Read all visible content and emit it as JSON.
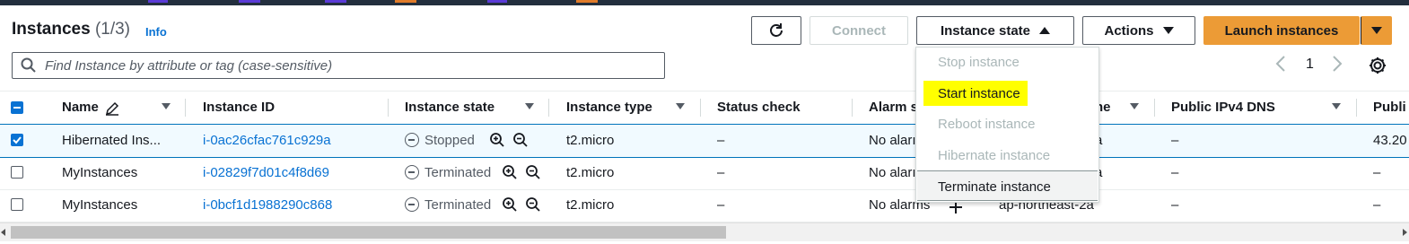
{
  "header": {
    "title": "Instances",
    "count": "(1/3)",
    "info": "Info"
  },
  "toolbar": {
    "connect": "Connect",
    "instance_state": "Instance state",
    "actions": "Actions",
    "launch": "Launch instances"
  },
  "search": {
    "placeholder": "Find Instance by attribute or tag (case-sensitive)"
  },
  "pagination": {
    "page": "1"
  },
  "columns": [
    "Name",
    "Instance ID",
    "Instance state",
    "Instance type",
    "Status check",
    "Alarm s",
    "ne",
    "Public IPv4 DNS",
    "Publi"
  ],
  "rows": [
    {
      "name": "Hibernated Ins...",
      "id": "i-0ac26cfac761c929a",
      "state": "Stopped",
      "type": "t2.micro",
      "status": "–",
      "alarm": "No aları",
      "zone": "a",
      "dns": "–",
      "ip": "43.20",
      "selected": true
    },
    {
      "name": "MyInstances",
      "id": "i-02829f7d01c4f8d69",
      "state": "Terminated",
      "type": "t2.micro",
      "status": "–",
      "alarm": "No aları",
      "zone": "a",
      "dns": "–",
      "ip": "–",
      "selected": false
    },
    {
      "name": "MyInstances",
      "id": "i-0bcf1d1988290c868",
      "state": "Terminated",
      "type": "t2.micro",
      "status": "–",
      "alarm": "No alarms",
      "zone": "ap-northeast-2a",
      "dns": "–",
      "ip": "–",
      "selected": false
    }
  ],
  "state_menu": {
    "items": [
      "Stop instance",
      "Start instance",
      "Reboot instance",
      "Hibernate instance",
      "Terminate instance"
    ],
    "highlight_color": "#ffff00"
  },
  "colors": {
    "accent": "#ec9b36",
    "link": "#0972d3",
    "topbar": "#232f3e"
  }
}
